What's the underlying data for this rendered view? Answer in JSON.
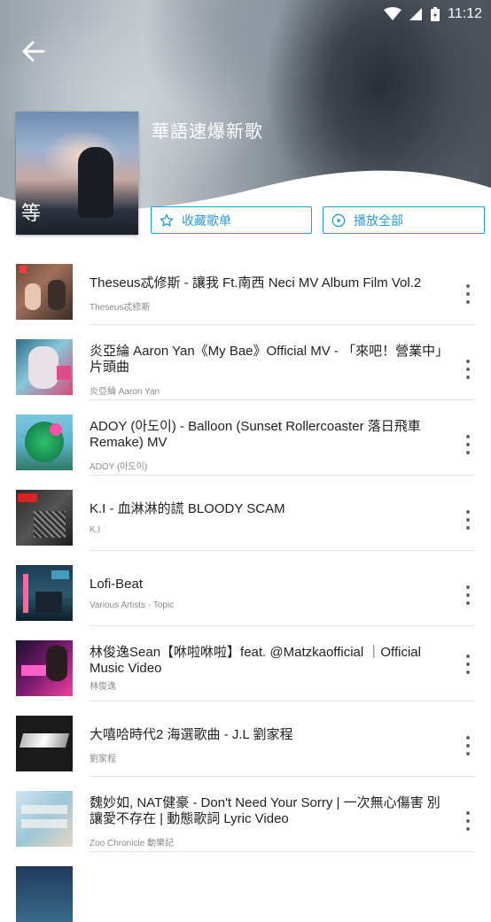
{
  "status_bar": {
    "time": "11:12"
  },
  "playlist": {
    "title": "華語速爆新歌",
    "favorite_label": "收藏歌单",
    "play_all_label": "播放全部",
    "cover_text": "等"
  },
  "songs": [
    {
      "title": "Theseus忒修斯 - 讓我 Ft.南西 Neci MV Album Film Vol.2",
      "artist": "Theseus忒修斯"
    },
    {
      "title": "炎亞綸 Aaron Yan《My Bae》Official MV - 「來吧！營業中」片頭曲",
      "artist": "炎亞綸 Aaron Yan"
    },
    {
      "title": "ADOY (아도이) - Balloon (Sunset Rollercoaster 落日飛車 Remake) MV",
      "artist": "ADOY (아도이)"
    },
    {
      "title": "K.I - 血淋淋的謊 BLOODY SCAM",
      "artist": "K.I"
    },
    {
      "title": "Lofi-Beat",
      "artist": "Various Artists - Topic"
    },
    {
      "title": "林俊逸Sean【咻啦咻啦】feat. @Matzkaofficial ｜Official Music Video",
      "artist": "林俊逸"
    },
    {
      "title": "大嘻哈時代2 海選歌曲 - J.L 劉家程",
      "artist": "劉家程"
    },
    {
      "title": "魏妙如, NAT健豪 - Don't Need Your Sorry | 一次無心傷害 別讓愛不存在 | 動態歌詞 Lyric Video",
      "artist": "Zoo Chronicle 動樂記"
    }
  ],
  "colors": {
    "accent": "#2f9bd3"
  }
}
